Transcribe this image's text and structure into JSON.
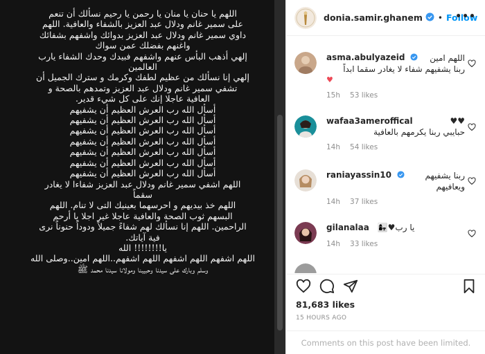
{
  "post": {
    "text": "اللهم يا حنان يا منان يا رحمن يا رحيم نسألك أن تنعم\nعلى سمير غانم ودلال عبد العزيز بالشفاء والعافية. اللهم\nداوي سمير غانم ودلال عبد العزيز بدوائك واشفهم بشفائك\nواغنهم بفضلك عمن سواك\nإلهي أذهب البأس عنهم واشفهم فبيدك وحدك الشفاء يارب\nالعالمين\nإلهي إنا نسألك من عظيم لطفك وكرمك و سترك الجميل أن\nتشفي سمير غانم ودلال عبد العزيز وتمدهم بالصحة و\nالعافية عاجلا إنك على كل شيء قدير.\nأسأل الله رب العرش العظيم أن يشفيهم\nأسأل الله رب العرش العظيم أن يشفيهم\nأسأل الله رب العرش العظيم أن يشفيهم\nأسأل الله رب العرش العظيم أن يشفيهم\nأسأل الله رب العرش العظيم أن يشفيهم\nأسأل الله رب العرش العظيم أن يشفيهم\nأسأل الله رب العرش العظيم أن يشفيهم\nاللهم اشفي سمير غانم ودلال عبد العزيز شفاءا لا يغادر\nسقماً\nاللهم خذ بيديهم و احرسهما بعينيك التى لا تنام. اللهم\nالبسهم ثوب الصحة والعافية عاجلا غير اجلا يا أرحم\nالراحمين. اللهم إنا نسألك لهم شفاءً جميلاً ودوداً حنوناً نرى\nفية آياتك.\nيا!!!!!!!! الله\nاللهم اشفهم اللهم اشفهم اللهم اشفهم..اللهم امين..وصلى الله\nوسلم وبارك على سيدنا وحبيبنا ومولانا سيدنا محمد ﷺ"
  },
  "header": {
    "username": "donia.samir.ghanem",
    "separator": "•",
    "follow_label": "Follow",
    "more_icon": "•••"
  },
  "comments": [
    {
      "username": "asma.abulyazeid",
      "text": "اللهم امين\nربنا يشفيهم شفاء لا يغادر سقما ابداً",
      "emoji": "♥",
      "time": "15h",
      "likes": "53 likes",
      "avatar_color": "#c9a78a"
    },
    {
      "username": "wafaa3ameroffical",
      "text": "♥♥\nحبايبي ربنا يكرمهم بالعافية",
      "time": "14h",
      "likes": "54 likes",
      "avatar_color": "#1a8f9a"
    },
    {
      "username": "raniayassin10",
      "text": "ربنا يشفيهم\nويعافيهم",
      "time": "14h",
      "likes": "37 likes",
      "avatar_color": "#c7a27c"
    },
    {
      "username": "gilanalaa",
      "text": "👩‍👧♥يا رب",
      "time": "14h",
      "likes": "33 likes",
      "avatar_color": "#7b3b52"
    }
  ],
  "actions": {
    "likes": "81,683 likes",
    "timestamp": "15 HOURS AGO",
    "comments_limited": "Comments on this post have been limited."
  },
  "colors": {
    "link_blue": "#0095f6",
    "verified_blue": "#3897f0",
    "heart_red": "#ed4956",
    "muted": "#8e8e8e"
  },
  "icons": [
    "heart-icon",
    "comment-icon",
    "share-icon",
    "bookmark-icon",
    "verified-icon",
    "more-icon"
  ]
}
